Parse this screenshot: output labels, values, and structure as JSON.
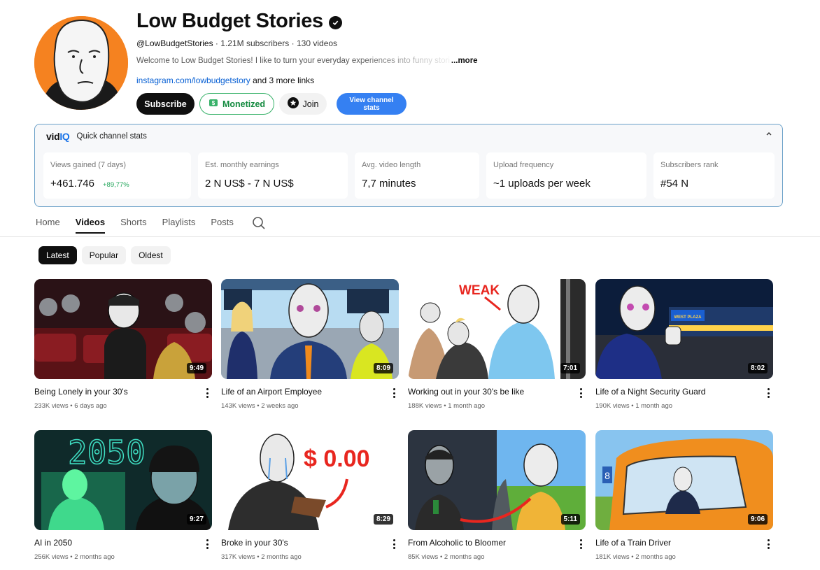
{
  "channel": {
    "title": "Low Budget Stories",
    "handle": "@LowBudgetStories",
    "subscribers": "1.21M subscribers",
    "videos": "130 videos",
    "separator": "·",
    "description": "Welcome to Low Budget Stories! I like to turn your everyday experiences into funny stori",
    "more": "...more",
    "link": "instagram.com/lowbudgetstory",
    "more_links": "and 3 more links"
  },
  "buttons": {
    "subscribe": "Subscribe",
    "monetized": "Monetized",
    "join": "Join",
    "stats": "View channel stats"
  },
  "vidiq": {
    "logo_a": "vid",
    "logo_b": "IQ",
    "heading": "Quick channel stats",
    "collapse_icon": "chevron-up-icon",
    "cards": [
      {
        "label": "Views gained (7 days)",
        "value": "+461.746",
        "extra": "+89,77%"
      },
      {
        "label": "Est. monthly earnings",
        "value": "2 N US$ - 7 N US$"
      },
      {
        "label": "Avg. video length",
        "value": "7,7 minutes"
      },
      {
        "label": "Upload frequency",
        "value": "~1 uploads per week"
      },
      {
        "label": "Subscribers rank",
        "value": "#54 N"
      }
    ]
  },
  "tabs": [
    "Home",
    "Videos",
    "Shorts",
    "Playlists",
    "Posts"
  ],
  "chips": [
    "Latest",
    "Popular",
    "Oldest"
  ],
  "videos": [
    {
      "title": "Being Lonely in your 30's",
      "views": "233K views",
      "age": "6 days ago",
      "duration": "9:49"
    },
    {
      "title": "Life of an Airport Employee",
      "views": "143K views",
      "age": "2 weeks ago",
      "duration": "8:09"
    },
    {
      "title": "Working out in your 30's be like",
      "views": "188K views",
      "age": "1 month ago",
      "duration": "7:01"
    },
    {
      "title": "Life of a Night Security Guard",
      "views": "190K views",
      "age": "1 month ago",
      "duration": "8:02"
    },
    {
      "title": "AI in 2050",
      "views": "256K views",
      "age": "2 months ago",
      "duration": "9:27"
    },
    {
      "title": "Broke in your 30's",
      "views": "317K views",
      "age": "2 months ago",
      "duration": "8:29"
    },
    {
      "title": "From Alcoholic to Bloomer",
      "views": "85K views",
      "age": "2 months ago",
      "duration": "5:11"
    },
    {
      "title": "Life of a Train Driver",
      "views": "181K views",
      "age": "2 months ago",
      "duration": "9:06"
    }
  ],
  "thumb_text": {
    "weak": "WEAK",
    "year": "2050",
    "money": "$ 0.00",
    "store": "WEST PLAZA",
    "platform": "8"
  },
  "colors": {
    "accent_blue": "#3580f2",
    "monetized_green": "#39b26a",
    "avatar_orange": "#f58220"
  }
}
